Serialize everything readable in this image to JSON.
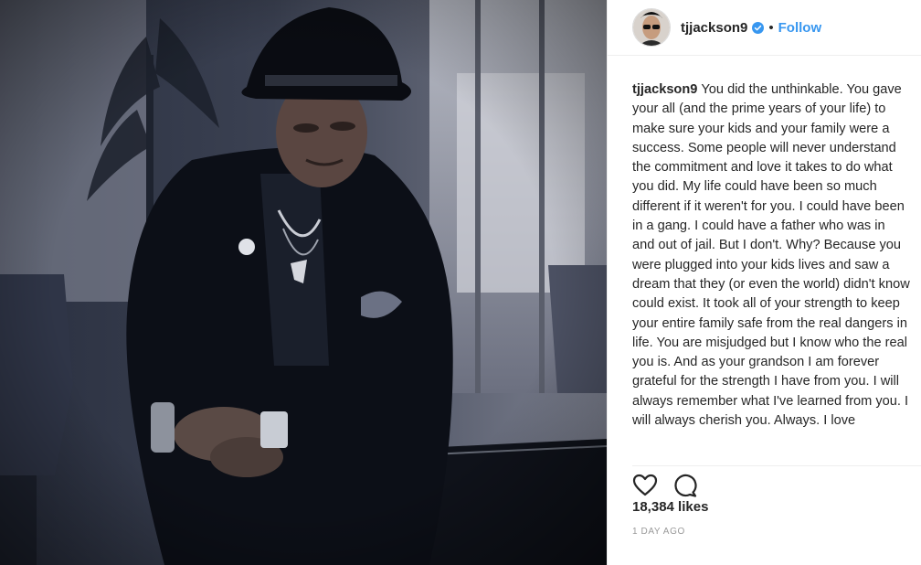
{
  "post": {
    "username": "tjjackson9",
    "verified_icon": "verified-badge-icon",
    "dot": "•",
    "follow_label": "Follow",
    "caption_username": "tjjackson9",
    "caption_text": "You did the unthinkable. You gave your all (and the prime years of your life) to make sure your kids and your family were a success. Some people will never understand the commitment and love it takes to do what you did. My life could have been so much different if it weren't for you. I could have been in a gang. I could have a father who was in and out of jail. But I don't. Why? Because you were plugged into your kids lives and saw a dream that they (or even the world) didn't know could exist. It took all of your strength to keep your entire family safe from the real dangers in life. You are misjudged but I know who the real you is. And as your grandson I am forever grateful for the strength I have from you. I will always remember what I've learned from you. I will always cherish you. Always. I love",
    "likes": "18,384 likes",
    "timestamp": "1 DAY AGO"
  },
  "icons": {
    "like": "heart-icon",
    "comment": "comment-icon"
  },
  "colors": {
    "link_blue": "#3897f0",
    "text": "#262626",
    "muted": "#999999",
    "border": "#efefef"
  }
}
